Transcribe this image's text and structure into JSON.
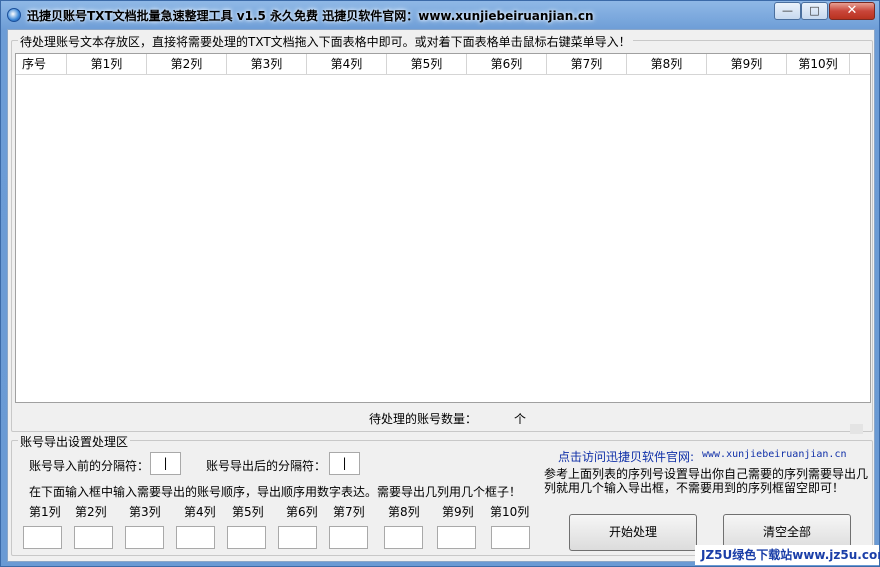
{
  "window": {
    "title": "迅捷贝账号TXT文档批量急速整理工具 v1.5  永久免费  迅捷贝软件官网：www.xunjiebeiruanjian.cn",
    "min_label": "—",
    "max_label": "□",
    "close_label": "✕"
  },
  "import_group": {
    "legend": "待处理账号文本存放区，直接将需要处理的TXT文档拖入下面表格中即可。或对着下面表格单击鼠标右键菜单导入！",
    "columns": [
      "序号",
      "第1列",
      "第2列",
      "第3列",
      "第4列",
      "第5列",
      "第6列",
      "第7列",
      "第8列",
      "第9列",
      "第10列"
    ],
    "count_label": "待处理的账号数量：",
    "count_value": "",
    "count_unit": "个"
  },
  "export_group": {
    "legend": "账号导出设置处理区",
    "import_sep_label": "账号导入前的分隔符：",
    "import_sep_value": "|",
    "export_sep_label": "账号导出后的分隔符：",
    "export_sep_value": "|",
    "instruction": "在下面输入框中输入需要导出的账号顺序，导出顺序用数字表达。需要导出几列用几个框子！",
    "order_labels": [
      "第1列",
      "第2列",
      "第3列",
      "第4列",
      "第5列",
      "第6列",
      "第7列",
      "第8列",
      "第9列",
      "第10列"
    ],
    "site_link_label": "点击访问迅捷贝软件官网:",
    "site_link_url": "www.xunjiebeiruanjian.cn",
    "hint": "参考上面列表的序列号设置导出你自己需要的序列需要导出几列就用几个输入导出框，不需要用到的序列框留空即可！",
    "start_button": "开始处理",
    "clear_button": "清空全部"
  },
  "watermark": "JZ5U绿色下载站www.jz5u.com"
}
